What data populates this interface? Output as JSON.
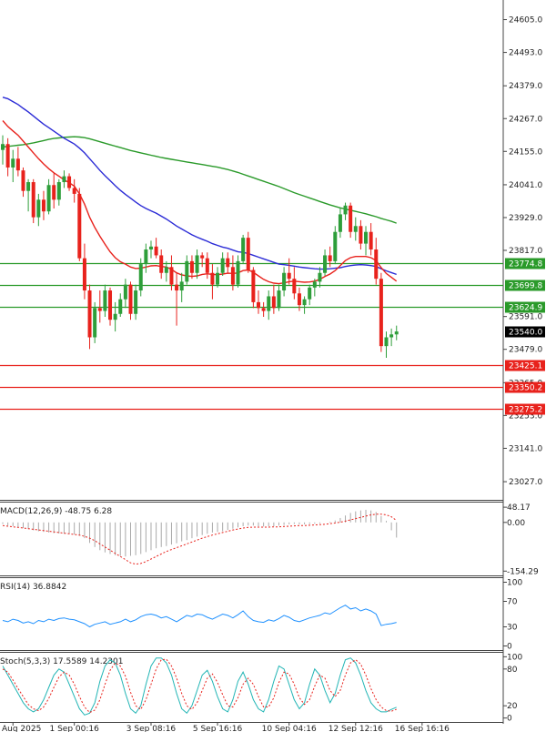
{
  "chart_data": {
    "type": "candlestick",
    "colors": {
      "bull": "#2e9e3a",
      "bear": "#e8221c",
      "ma_fast": "#e8221c",
      "ma_mid": "#2b2bd6",
      "ma_slow": "#2a9a2a",
      "support": "#2a9a2a",
      "resistance": "#e8221c",
      "current": "#000000",
      "macd_signal": "#e8221c",
      "macd_hist": "#a9a9a9",
      "rsi": "#1e90ff",
      "stoch_main": "#22b5b5",
      "stoch_signal": "#e8221c"
    },
    "price_axis": {
      "ticks": [
        "24605.0",
        "24493.0",
        "24379.0",
        "24267.0",
        "24155.0",
        "24041.0",
        "23929.0",
        "23817.0",
        "23591.0",
        "23479.0",
        "23365.0",
        "23253.0",
        "23141.0",
        "23027.0"
      ],
      "tick_values": [
        24605,
        24493,
        24379,
        24267,
        24155,
        24041,
        23929,
        23817,
        23591,
        23479,
        23365,
        23253,
        23141,
        23027
      ],
      "range": [
        22965,
        24672
      ]
    },
    "x_labels": [
      "Aug 2025",
      "1 Sep 00:16",
      "3 Sep 08:16",
      "5 Sep 16:16",
      "10 Sep 04:16",
      "12 Sep 12:16",
      "16 Sep 16:16"
    ],
    "x_label_index": [
      2,
      14,
      29,
      42,
      56,
      69,
      82
    ],
    "current_price": {
      "label": "23540.0",
      "value": 23540.0
    },
    "levels": [
      {
        "label": "23774.8",
        "value": 23774.8,
        "kind": "support"
      },
      {
        "label": "23699.8",
        "value": 23699.8,
        "kind": "support"
      },
      {
        "label": "23624.9",
        "value": 23624.9,
        "kind": "support"
      },
      {
        "label": "23425.1",
        "value": 23425.1,
        "kind": "resistance"
      },
      {
        "label": "23350.2",
        "value": 23350.2,
        "kind": "resistance"
      },
      {
        "label": "23275.2",
        "value": 23275.2,
        "kind": "resistance"
      }
    ],
    "candles": [
      [
        24160,
        24210,
        24110,
        24180
      ],
      [
        24180,
        24200,
        24070,
        24100
      ],
      [
        24100,
        24160,
        24050,
        24130
      ],
      [
        24130,
        24170,
        24070,
        24090
      ],
      [
        24090,
        24100,
        24000,
        24020
      ],
      [
        24020,
        24060,
        23950,
        24050
      ],
      [
        24050,
        24060,
        23910,
        23930
      ],
      [
        23930,
        24010,
        23900,
        23990
      ],
      [
        23990,
        24020,
        23920,
        23950
      ],
      [
        23950,
        24060,
        23940,
        24040
      ],
      [
        24040,
        24080,
        23960,
        23990
      ],
      [
        23990,
        24060,
        23970,
        24050
      ],
      [
        24050,
        24090,
        24030,
        24070
      ],
      [
        24070,
        24080,
        24020,
        24030
      ],
      [
        24030,
        24060,
        23980,
        24010
      ],
      [
        24010,
        24030,
        23780,
        23790
      ],
      [
        23790,
        23840,
        23650,
        23680
      ],
      [
        23680,
        23700,
        23480,
        23520
      ],
      [
        23520,
        23640,
        23500,
        23620
      ],
      [
        23620,
        23680,
        23570,
        23610
      ],
      [
        23610,
        23700,
        23590,
        23680
      ],
      [
        23680,
        23690,
        23560,
        23580
      ],
      [
        23580,
        23640,
        23540,
        23600
      ],
      [
        23600,
        23670,
        23590,
        23650
      ],
      [
        23650,
        23720,
        23620,
        23700
      ],
      [
        23700,
        23710,
        23580,
        23600
      ],
      [
        23600,
        23700,
        23580,
        23680
      ],
      [
        23680,
        23790,
        23660,
        23770
      ],
      [
        23770,
        23840,
        23740,
        23820
      ],
      [
        23820,
        23850,
        23790,
        23830
      ],
      [
        23830,
        23860,
        23790,
        23800
      ],
      [
        23800,
        23820,
        23720,
        23740
      ],
      [
        23740,
        23780,
        23710,
        23760
      ],
      [
        23760,
        23800,
        23680,
        23700
      ],
      [
        23700,
        23740,
        23560,
        23680
      ],
      [
        23680,
        23740,
        23640,
        23710
      ],
      [
        23710,
        23800,
        23700,
        23780
      ],
      [
        23780,
        23800,
        23720,
        23740
      ],
      [
        23740,
        23820,
        23720,
        23800
      ],
      [
        23800,
        23810,
        23760,
        23790
      ],
      [
        23790,
        23810,
        23720,
        23740
      ],
      [
        23740,
        23770,
        23650,
        23700
      ],
      [
        23700,
        23760,
        23690,
        23740
      ],
      [
        23740,
        23810,
        23730,
        23790
      ],
      [
        23790,
        23810,
        23740,
        23760
      ],
      [
        23760,
        23800,
        23680,
        23700
      ],
      [
        23700,
        23800,
        23690,
        23780
      ],
      [
        23780,
        23870,
        23770,
        23860
      ],
      [
        23860,
        23880,
        23740,
        23750
      ],
      [
        23750,
        23760,
        23620,
        23640
      ],
      [
        23640,
        23680,
        23600,
        23620
      ],
      [
        23620,
        23640,
        23590,
        23610
      ],
      [
        23610,
        23680,
        23580,
        23660
      ],
      [
        23660,
        23700,
        23600,
        23620
      ],
      [
        23620,
        23700,
        23610,
        23680
      ],
      [
        23680,
        23760,
        23660,
        23740
      ],
      [
        23740,
        23790,
        23700,
        23720
      ],
      [
        23720,
        23760,
        23650,
        23670
      ],
      [
        23670,
        23690,
        23610,
        23630
      ],
      [
        23630,
        23660,
        23600,
        23650
      ],
      [
        23650,
        23700,
        23630,
        23690
      ],
      [
        23690,
        23720,
        23660,
        23710
      ],
      [
        23710,
        23760,
        23690,
        23740
      ],
      [
        23740,
        23820,
        23730,
        23800
      ],
      [
        23800,
        23830,
        23760,
        23780
      ],
      [
        23780,
        23900,
        23770,
        23880
      ],
      [
        23880,
        23960,
        23860,
        23940
      ],
      [
        23940,
        23980,
        23920,
        23970
      ],
      [
        23970,
        23980,
        23860,
        23880
      ],
      [
        23880,
        23930,
        23850,
        23900
      ],
      [
        23900,
        23920,
        23820,
        23840
      ],
      [
        23840,
        23900,
        23800,
        23880
      ],
      [
        23880,
        23910,
        23800,
        23820
      ],
      [
        23820,
        23860,
        23700,
        23720
      ],
      [
        23720,
        23740,
        23470,
        23490
      ],
      [
        23490,
        23540,
        23450,
        23520
      ],
      [
        23520,
        23550,
        23490,
        23530
      ],
      [
        23530,
        23560,
        23510,
        23540
      ]
    ],
    "ma_fast": [
      24260,
      24240,
      24225,
      24210,
      24190,
      24170,
      24150,
      24130,
      24112,
      24096,
      24082,
      24070,
      24058,
      24048,
      24036,
      24010,
      23975,
      23930,
      23895,
      23865,
      23838,
      23812,
      23792,
      23778,
      23770,
      23760,
      23755,
      23756,
      23760,
      23764,
      23765,
      23762,
      23760,
      23752,
      23740,
      23733,
      23730,
      23728,
      23730,
      23735,
      23737,
      23735,
      23734,
      23736,
      23739,
      23738,
      23740,
      23748,
      23750,
      23742,
      23730,
      23718,
      23710,
      23705,
      23703,
      23706,
      23710,
      23712,
      23710,
      23708,
      23709,
      23712,
      23718,
      23728,
      23736,
      23748,
      23765,
      23782,
      23792,
      23796,
      23796,
      23796,
      23792,
      23782,
      23758,
      23738,
      23725,
      23712
    ],
    "ma_mid": [
      24340,
      24335,
      24325,
      24315,
      24302,
      24290,
      24276,
      24262,
      24248,
      24236,
      24224,
      24212,
      24200,
      24190,
      24180,
      24166,
      24150,
      24130,
      24110,
      24090,
      24072,
      24055,
      24038,
      24022,
      24008,
      23995,
      23982,
      23970,
      23960,
      23952,
      23944,
      23934,
      23924,
      23912,
      23900,
      23890,
      23880,
      23870,
      23862,
      23855,
      23848,
      23840,
      23834,
      23828,
      23824,
      23818,
      23812,
      23810,
      23806,
      23800,
      23794,
      23788,
      23782,
      23776,
      23770,
      23768,
      23766,
      23763,
      23760,
      23758,
      23756,
      23754,
      23753,
      23753,
      23754,
      23756,
      23758,
      23762,
      23765,
      23767,
      23768,
      23767,
      23765,
      23762,
      23754,
      23747,
      23741,
      23735
    ],
    "ma_slow": [
      24170,
      24172,
      24174,
      24176,
      24178,
      24181,
      24184,
      24188,
      24192,
      24196,
      24199,
      24201,
      24203,
      24204,
      24205,
      24204,
      24202,
      24198,
      24193,
      24188,
      24183,
      24178,
      24173,
      24168,
      24163,
      24158,
      24154,
      24150,
      24146,
      24142,
      24138,
      24134,
      24131,
      24128,
      24125,
      24122,
      24119,
      24116,
      24113,
      24110,
      24107,
      24104,
      24101,
      24097,
      24093,
      24088,
      24083,
      24077,
      24071,
      24065,
      24059,
      24053,
      24047,
      24041,
      24035,
      24028,
      24021,
      24014,
      24008,
      24002,
      23996,
      23990,
      23984,
      23978,
      23972,
      23967,
      23962,
      23958,
      23954,
      23950,
      23946,
      23942,
      23937,
      23932,
      23926,
      23921,
      23916,
      23910
    ],
    "macd": {
      "label": "MACD(12,26,9) -48.75 6.28",
      "ticks": [
        "48.17",
        "0.00",
        "-154.29"
      ],
      "tick_values": [
        48.17,
        0,
        -154.29
      ],
      "range": [
        -165,
        60
      ],
      "hist": [
        -5,
        -10,
        -12,
        -15,
        -18,
        -20,
        -25,
        -28,
        -30,
        -32,
        -34,
        -35,
        -36,
        -37,
        -38,
        -42,
        -50,
        -65,
        -78,
        -88,
        -95,
        -100,
        -104,
        -106,
        -108,
        -106,
        -104,
        -100,
        -94,
        -88,
        -82,
        -78,
        -75,
        -70,
        -66,
        -60,
        -56,
        -50,
        -45,
        -40,
        -36,
        -32,
        -30,
        -28,
        -24,
        -20,
        -16,
        -12,
        -10,
        -10,
        -12,
        -13,
        -12,
        -12,
        -10,
        -8,
        -6,
        -5,
        -6,
        -6,
        -5,
        -4,
        -3,
        0,
        2,
        6,
        14,
        22,
        30,
        35,
        38,
        40,
        38,
        33,
        20,
        5,
        -25,
        -48
      ],
      "signal": [
        -10,
        -12,
        -14,
        -16,
        -18,
        -20,
        -22,
        -24,
        -26,
        -28,
        -30,
        -32,
        -34,
        -36,
        -38,
        -40,
        -44,
        -50,
        -58,
        -68,
        -78,
        -88,
        -98,
        -108,
        -118,
        -128,
        -132,
        -130,
        -124,
        -116,
        -108,
        -100,
        -92,
        -86,
        -80,
        -74,
        -68,
        -62,
        -56,
        -50,
        -45,
        -40,
        -36,
        -32,
        -28,
        -24,
        -21,
        -18,
        -16,
        -15,
        -15,
        -15,
        -15,
        -14,
        -14,
        -13,
        -12,
        -11,
        -10,
        -10,
        -9,
        -8,
        -7,
        -6,
        -4,
        -2,
        1,
        4,
        8,
        12,
        16,
        20,
        24,
        26,
        26,
        24,
        18,
        6
      ]
    },
    "rsi": {
      "label": "RSI(14) 36.8842",
      "ticks": [
        "100",
        "70",
        "30",
        "0"
      ],
      "tick_values": [
        100,
        70,
        30,
        0
      ],
      "range": [
        -5,
        105
      ],
      "values": [
        40,
        38,
        42,
        40,
        36,
        38,
        35,
        40,
        38,
        42,
        40,
        43,
        44,
        42,
        41,
        38,
        35,
        30,
        34,
        36,
        38,
        34,
        36,
        38,
        42,
        38,
        41,
        46,
        49,
        50,
        48,
        44,
        46,
        42,
        38,
        43,
        48,
        46,
        50,
        49,
        45,
        42,
        46,
        50,
        48,
        44,
        49,
        55,
        46,
        40,
        38,
        37,
        41,
        39,
        43,
        48,
        45,
        40,
        38,
        41,
        44,
        46,
        48,
        52,
        50,
        55,
        60,
        64,
        58,
        60,
        55,
        58,
        55,
        50,
        32,
        34,
        35,
        37
      ]
    },
    "stoch": {
      "label": "Stoch(5,3,3) 17.5589 14.2301",
      "ticks": [
        "100",
        "80",
        "20",
        "0"
      ],
      "tick_values": [
        100,
        80,
        20,
        0
      ],
      "range": [
        -5,
        105
      ],
      "main": [
        85,
        70,
        55,
        40,
        25,
        15,
        10,
        15,
        30,
        50,
        70,
        80,
        75,
        55,
        35,
        15,
        5,
        8,
        25,
        60,
        85,
        95,
        90,
        70,
        40,
        15,
        8,
        20,
        55,
        85,
        98,
        98,
        90,
        70,
        40,
        15,
        8,
        20,
        45,
        70,
        78,
        60,
        35,
        15,
        10,
        30,
        60,
        75,
        55,
        30,
        15,
        10,
        30,
        60,
        85,
        80,
        55,
        30,
        15,
        25,
        55,
        80,
        70,
        45,
        25,
        40,
        70,
        95,
        98,
        90,
        70,
        45,
        25,
        15,
        10,
        10,
        14,
        17.56
      ],
      "signal": [
        80,
        75,
        62,
        48,
        35,
        22,
        15,
        12,
        18,
        32,
        50,
        67,
        75,
        70,
        55,
        35,
        18,
        9,
        13,
        30,
        55,
        78,
        90,
        85,
        68,
        42,
        20,
        14,
        30,
        55,
        80,
        95,
        96,
        85,
        65,
        40,
        20,
        14,
        25,
        45,
        65,
        72,
        58,
        38,
        20,
        18,
        33,
        55,
        65,
        55,
        35,
        18,
        18,
        33,
        58,
        75,
        72,
        55,
        33,
        22,
        30,
        52,
        70,
        65,
        45,
        35,
        45,
        70,
        90,
        95,
        88,
        70,
        48,
        30,
        18,
        12,
        11,
        14.23
      ]
    }
  }
}
